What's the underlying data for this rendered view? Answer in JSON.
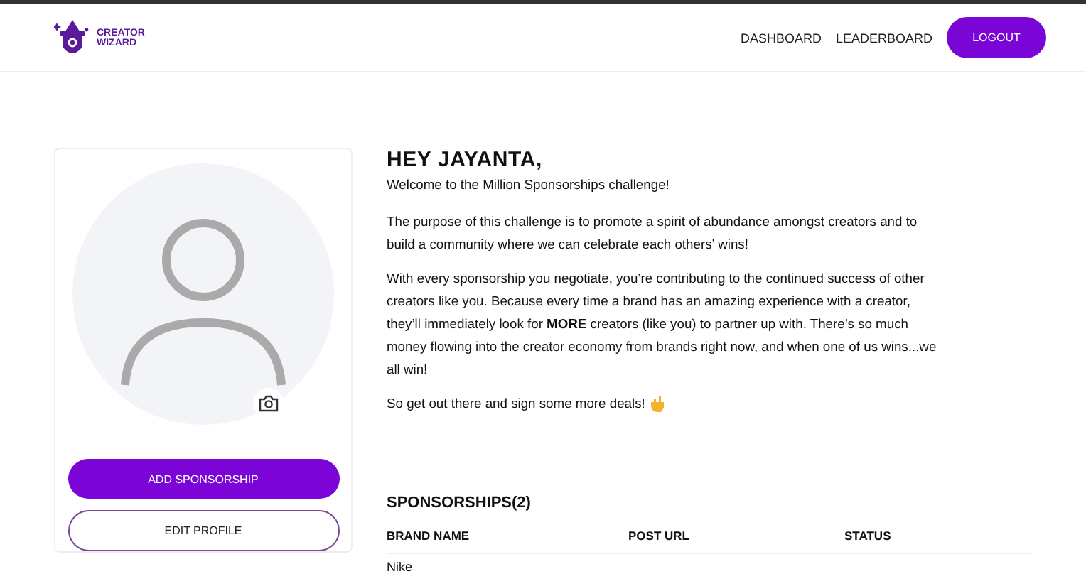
{
  "logo": {
    "line1": "CREATOR",
    "line2": "WIZARD"
  },
  "nav": {
    "links": [
      {
        "label": "DASHBOARD"
      },
      {
        "label": "LEADERBOARD"
      }
    ],
    "logout": "LOGOUT"
  },
  "profile": {
    "buttons": [
      {
        "label": "ADD SPONSORSHIP",
        "kind": "primary"
      },
      {
        "label": "EDIT PROFILE",
        "kind": "outline"
      }
    ]
  },
  "greeting": "HEY JAYANTA,",
  "paragraphs": [
    "Welcome to the Million Sponsorships challenge!",
    "The purpose of this challenge is to promote a spirit of abundance amongst creators and to build a community where we can celebrate each others’ wins!",
    "With every sponsorship you negotiate, you’re contributing to the continued success of other creators like you. Because every time a brand has an amazing experience with a creator, they’ll immediately look for **MORE** creators (like you) to partner up with. There’s so much money flowing into the creator economy from brands right now, and when one of us wins...we all win!",
    "So get out there and sign some more deals!"
  ],
  "sponsorships": {
    "title": "SPONSORSHIPS(2)",
    "columns": [
      "BRAND NAME",
      "POST URL",
      "STATUS"
    ],
    "rows": [
      [
        "Nike"
      ]
    ]
  }
}
